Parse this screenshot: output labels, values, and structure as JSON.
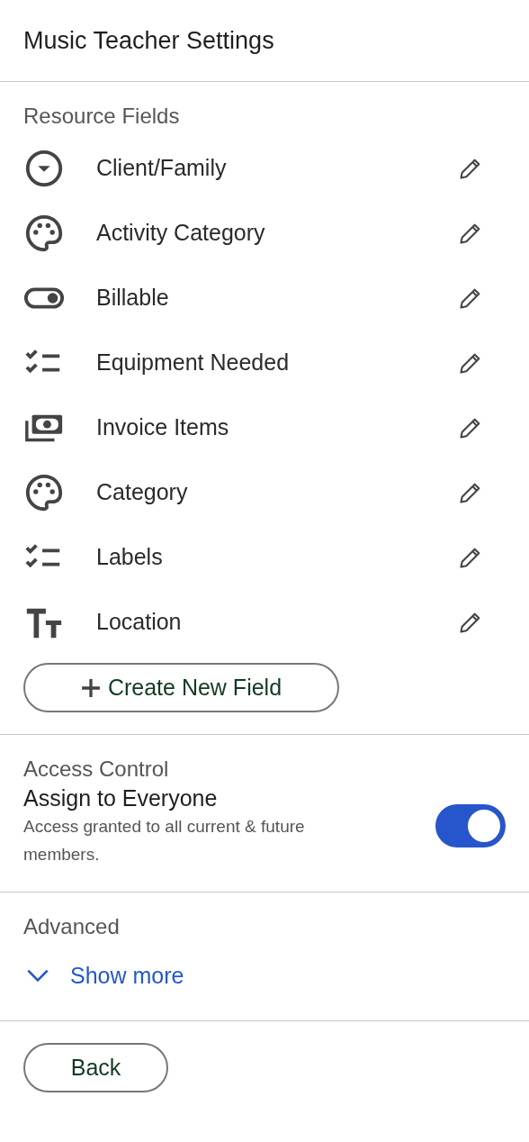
{
  "header": {
    "title": "Music Teacher Settings"
  },
  "resource_fields": {
    "heading": "Resource Fields",
    "fields": [
      {
        "kind": "dropdown",
        "label": "Client/Family"
      },
      {
        "kind": "palette",
        "label": "Activity Category"
      },
      {
        "kind": "toggle",
        "label": "Billable"
      },
      {
        "kind": "checklist",
        "label": "Equipment Needed"
      },
      {
        "kind": "money",
        "label": "Invoice Items"
      },
      {
        "kind": "palette",
        "label": "Category"
      },
      {
        "kind": "checklist",
        "label": "Labels"
      },
      {
        "kind": "text",
        "label": "Location"
      }
    ],
    "create_button": "Create New Field"
  },
  "access_control": {
    "heading": "Access Control",
    "title": "Assign to Everyone",
    "description": "Access granted to all current & future members.",
    "on": true
  },
  "advanced": {
    "heading": "Advanced",
    "toggle_label": "Show more",
    "expanded": false
  },
  "back_button": "Back"
}
